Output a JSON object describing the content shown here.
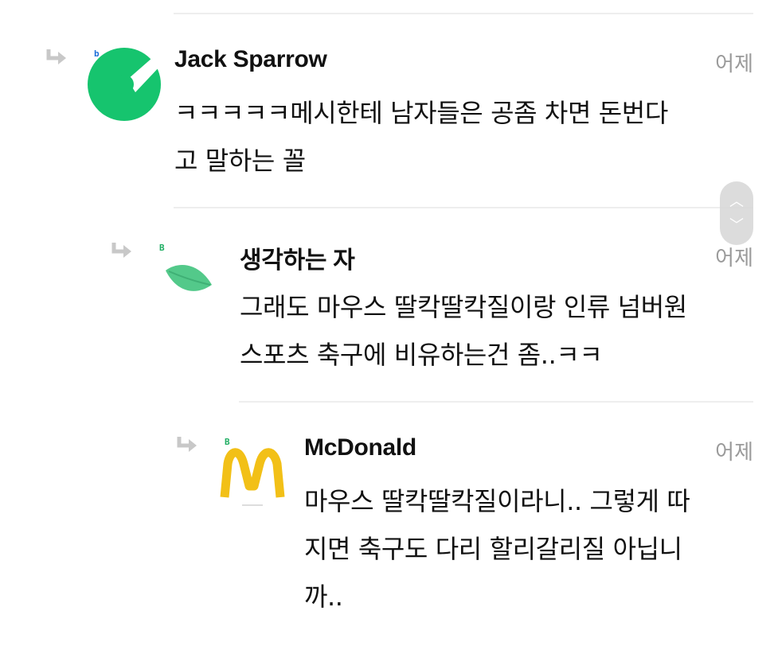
{
  "comments": [
    {
      "level_badge": "b",
      "level_color": "#1e6fd9",
      "author": "Jack Sparrow",
      "time": "어제",
      "lines": [
        "ㅋㅋㅋㅋㅋ메시한테 남자들은 공좀 차면 돈번다",
        "고 말하는 꼴"
      ],
      "avatar_icon": "green-check-logo-icon",
      "avatar_color": "#16c46e"
    },
    {
      "level_badge": "B",
      "level_color": "#1fae63",
      "author": "생각하는 자",
      "time": "어제",
      "lines": [
        "그래도 마우스 딸칵딸칵질이랑 인류 넘버원",
        "스포츠 축구에 비유하는건 좀..ㅋㅋ"
      ],
      "avatar_icon": "leaf-icon",
      "avatar_color": "#53c98a"
    },
    {
      "level_badge": "B",
      "level_color": "#1fae63",
      "author": "McDonald",
      "time": "어제",
      "lines": [
        "마우스 딸칵딸칵질이라니.. 그렇게 따",
        "지면 축구도 다리 할리갈리질 아닙니",
        "까.."
      ],
      "avatar_icon": "golden-arches-icon",
      "avatar_color": "#f2c017"
    }
  ],
  "scroll_controls": {
    "up_icon": "chevron-up-icon",
    "down_icon": "chevron-down-icon"
  }
}
